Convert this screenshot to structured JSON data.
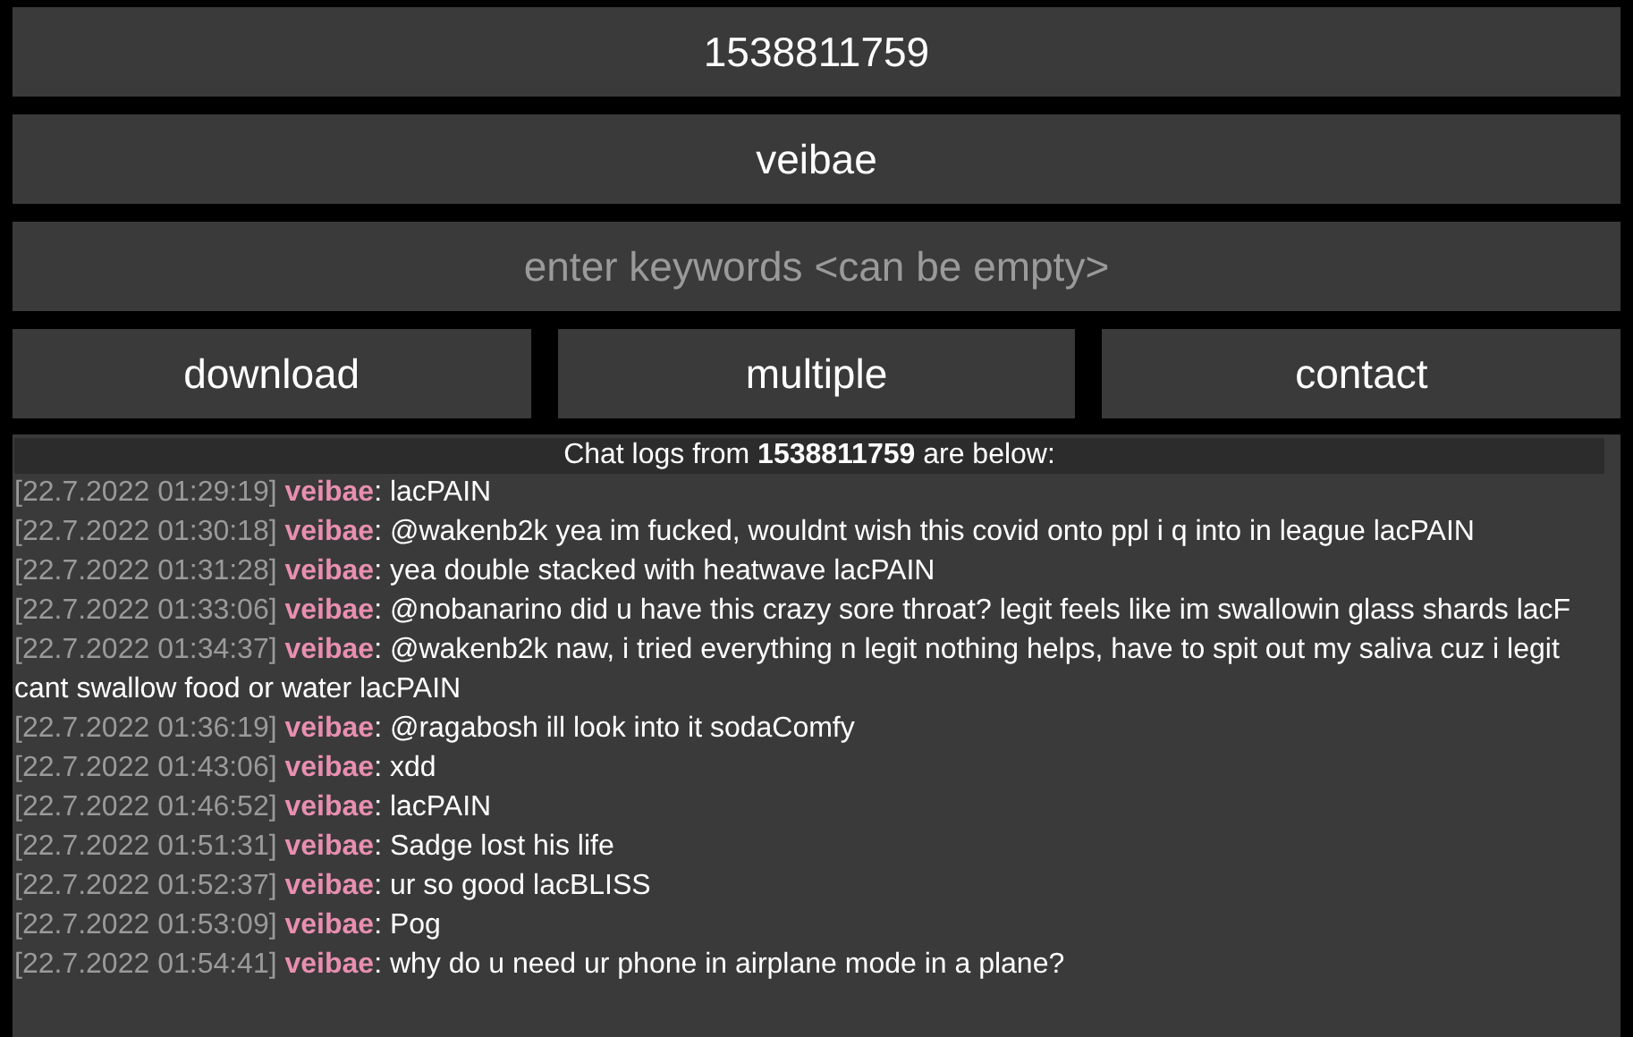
{
  "fields": [
    {
      "value": "1538811759"
    },
    {
      "value": "veibae"
    },
    {
      "placeholder": "enter keywords <can be empty>"
    }
  ],
  "buttons": [
    "download",
    "multiple",
    "contact"
  ],
  "chat": {
    "header": "Chat logs from **1538811759** are below:",
    "messages": [
      {
        "time": "[22.7.2022 01:29:19]",
        "user": "veibae",
        "text": ": lacPAIN"
      },
      {
        "time": "[22.7.2022 01:30:18]",
        "user": "veibae",
        "text": ": @wakenb2k yea im fucked, wouldnt wish this covid onto ppl i q into in league lacPAIN"
      },
      {
        "time": "[22.7.2022 01:31:28]",
        "user": "veibae",
        "text": ": yea double stacked with heatwave lacPAIN"
      },
      {
        "time": "[22.7.2022 01:33:06]",
        "user": "veibae",
        "text": ": @nobanarino did u have this crazy sore throat? legit feels like im swallowin glass shards lacF"
      },
      {
        "time": "[22.7.2022 01:34:37]",
        "user": "veibae",
        "text": ": @wakenb2k naw, i tried everything n legit nothing helps, have to spit out my saliva cuz i legit cant swallow food or water lacPAIN"
      },
      {
        "time": "[22.7.2022 01:36:19]",
        "user": "veibae",
        "text": ": @ragabosh ill look into it sodaComfy"
      },
      {
        "time": "[22.7.2022 01:43:06]",
        "user": "veibae",
        "text": ": xdd"
      },
      {
        "time": "[22.7.2022 01:46:52]",
        "user": "veibae",
        "text": ": lacPAIN"
      },
      {
        "time": "[22.7.2022 01:51:31]",
        "user": "veibae",
        "text": ": Sadge lost his life"
      },
      {
        "time": "[22.7.2022 01:52:37]",
        "user": "veibae",
        "text": ": ur so good lacBLISS"
      },
      {
        "time": "[22.7.2022 01:53:09]",
        "user": "veibae",
        "text": ": Pog"
      },
      {
        "time": "[22.7.2022 01:54:41]",
        "user": "veibae",
        "text": ": why do u need ur phone in airplane mode in a plane?"
      }
    ]
  }
}
